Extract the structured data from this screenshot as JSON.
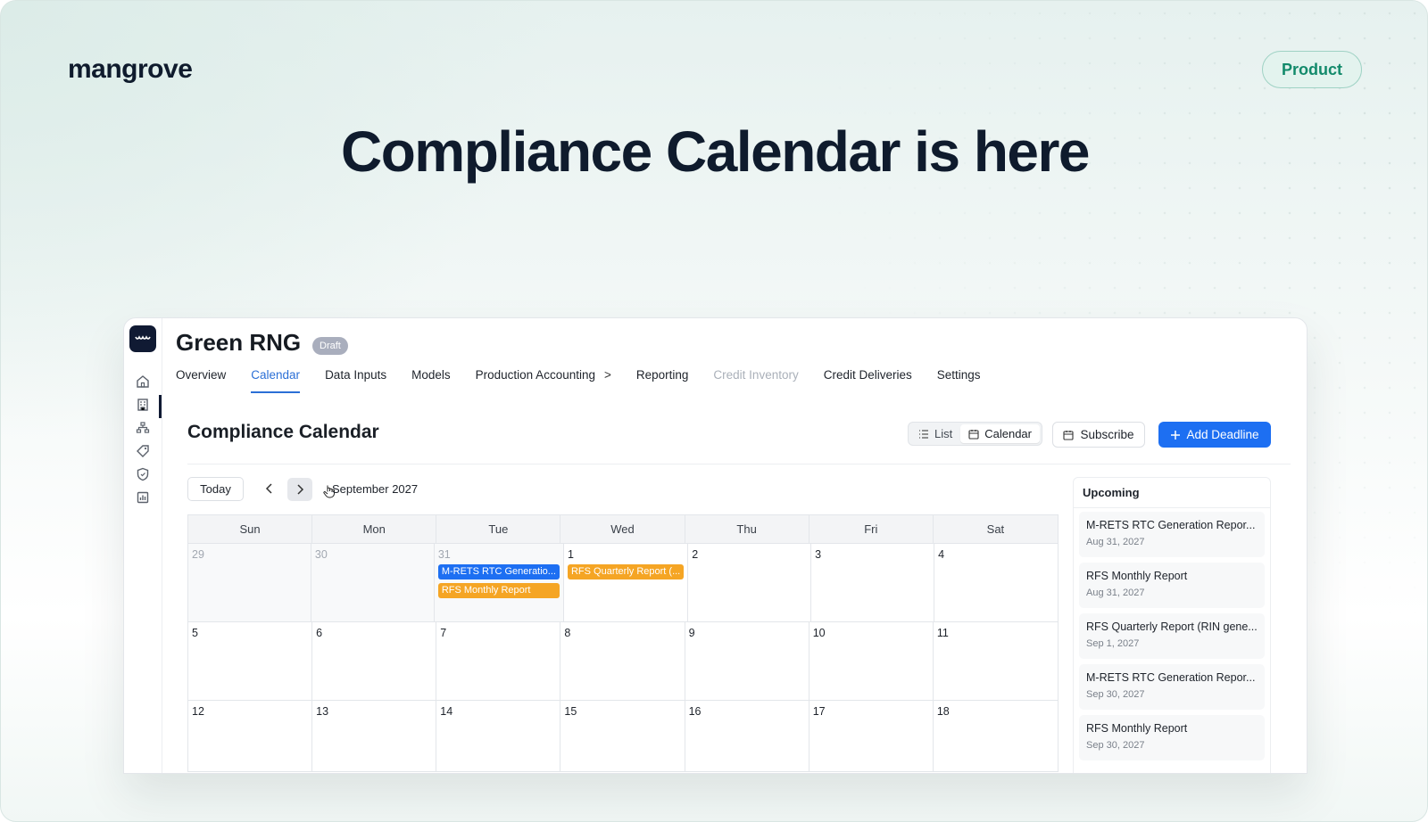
{
  "brand": "mangrove",
  "badge": "Product",
  "headline": "Compliance Calendar is here",
  "app": {
    "project_title": "Green RNG",
    "status_badge": "Draft",
    "tabs": [
      {
        "label": "Overview"
      },
      {
        "label": "Calendar",
        "active": true
      },
      {
        "label": "Data Inputs"
      },
      {
        "label": "Models"
      },
      {
        "label": "Production Accounting",
        "chevron": ">"
      },
      {
        "label": "Reporting"
      },
      {
        "label": "Credit Inventory",
        "disabled": true
      },
      {
        "label": "Credit Deliveries"
      },
      {
        "label": "Settings"
      }
    ],
    "section_title": "Compliance Calendar",
    "view_toggle": {
      "list": "List",
      "calendar": "Calendar",
      "selected": "Calendar"
    },
    "subscribe_label": "Subscribe",
    "add_label": "Add Deadline",
    "today_label": "Today",
    "prev_icon": "chevron-left-icon",
    "next_icon": "chevron-right-icon",
    "month_label": "September 2027",
    "weekdays": [
      "Sun",
      "Mon",
      "Tue",
      "Wed",
      "Thu",
      "Fri",
      "Sat"
    ],
    "weeks": [
      {
        "days": [
          {
            "num": "29",
            "other": true,
            "events": []
          },
          {
            "num": "30",
            "other": true,
            "events": []
          },
          {
            "num": "31",
            "other": true,
            "events": [
              {
                "label": "M-RETS RTC Generatio...",
                "color": "blue"
              },
              {
                "label": "RFS Monthly Report",
                "color": "orange"
              }
            ]
          },
          {
            "num": "1",
            "events": [
              {
                "label": "RFS Quarterly Report (...",
                "color": "orange"
              }
            ]
          },
          {
            "num": "2",
            "events": []
          },
          {
            "num": "3",
            "events": []
          },
          {
            "num": "4",
            "events": []
          }
        ]
      },
      {
        "days": [
          {
            "num": "5",
            "events": []
          },
          {
            "num": "6",
            "events": []
          },
          {
            "num": "7",
            "events": []
          },
          {
            "num": "8",
            "events": []
          },
          {
            "num": "9",
            "events": []
          },
          {
            "num": "10",
            "events": []
          },
          {
            "num": "11",
            "events": []
          }
        ]
      },
      {
        "days": [
          {
            "num": "12",
            "events": []
          },
          {
            "num": "13",
            "events": []
          },
          {
            "num": "14",
            "events": []
          },
          {
            "num": "15",
            "events": []
          },
          {
            "num": "16",
            "events": []
          },
          {
            "num": "17",
            "events": []
          },
          {
            "num": "18",
            "events": []
          }
        ]
      }
    ],
    "upcoming": {
      "title": "Upcoming",
      "items": [
        {
          "title": "M-RETS RTC Generation Repor...",
          "date": "Aug 31, 2027"
        },
        {
          "title": "RFS Monthly Report",
          "date": "Aug 31, 2027"
        },
        {
          "title": "RFS Quarterly Report (RIN gene...",
          "date": "Sep 1, 2027"
        },
        {
          "title": "M-RETS RTC Generation Repor...",
          "date": "Sep 30, 2027"
        },
        {
          "title": "RFS Monthly Report",
          "date": "Sep 30, 2027"
        }
      ]
    },
    "rail_icons": [
      "home-icon",
      "building-icon",
      "org-chart-icon",
      "tag-icon",
      "shield-icon",
      "report-icon"
    ]
  },
  "colors": {
    "accent": "#1d6ff2",
    "event_blue": "#1d6ff2",
    "event_orange": "#f5a524",
    "badge_green": "#138a6b",
    "headline": "#0f1b2d"
  }
}
